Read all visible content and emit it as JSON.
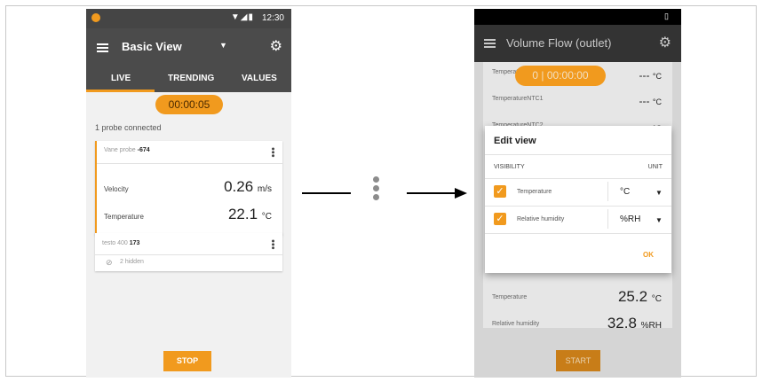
{
  "left_screen": {
    "status": {
      "time": "12:30"
    },
    "app_title": "Basic View",
    "tabs": [
      "LIVE",
      "TRENDING",
      "VALUES"
    ],
    "active_tab": "LIVE",
    "timer": "00:00:05",
    "probes_connected": "1 probe connected",
    "card1": {
      "probe_label": "Vane probe",
      "probe_id": "-674",
      "rows": [
        {
          "label": "Velocity",
          "value": "0.26",
          "unit": "m/s"
        },
        {
          "label": "Temperature",
          "value": "22.1",
          "unit": "°C"
        }
      ]
    },
    "card2": {
      "probe_label": "testo 400",
      "probe_id": "173",
      "hidden": "2 hidden"
    },
    "stop_label": "STOP"
  },
  "right_screen": {
    "app_title": "Volume Flow (outlet)",
    "timer": "0 | 00:00:00",
    "bg_rows": [
      {
        "label": "TemperatureTC2",
        "value": "---",
        "unit": "°C"
      },
      {
        "label": "TemperatureNTC1",
        "value": "---",
        "unit": "°C"
      },
      {
        "label": "TemperatureNTC2",
        "value": "---",
        "unit": "°C"
      }
    ],
    "bottom_rows": [
      {
        "label": "Temperature",
        "value": "25.2",
        "unit": "°C"
      },
      {
        "label": "Relative humidity",
        "value": "32.8",
        "unit": "%RH"
      }
    ],
    "start_label": "START",
    "dialog": {
      "title": "Edit view",
      "visibility_label": "VISIBILITY",
      "unit_label": "UNIT",
      "rows": [
        {
          "label": "Temperature",
          "unit": "°C",
          "checked": true
        },
        {
          "label": "Relative humidity",
          "unit": "%RH",
          "checked": true
        }
      ],
      "ok_label": "OK"
    }
  },
  "colors": {
    "accent": "#f19a1e",
    "appbar": "#4b4b4b"
  }
}
